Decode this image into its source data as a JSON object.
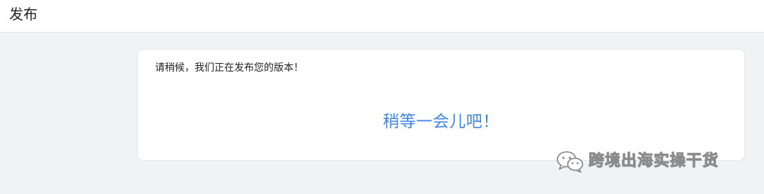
{
  "header": {
    "title": "发布"
  },
  "card": {
    "message": "请稍候，我们正在发布您的版本！",
    "wait_text": "稍等一会儿吧！"
  },
  "watermark": {
    "icon": "wechat-icon",
    "text": "跨境出海实操干货"
  }
}
